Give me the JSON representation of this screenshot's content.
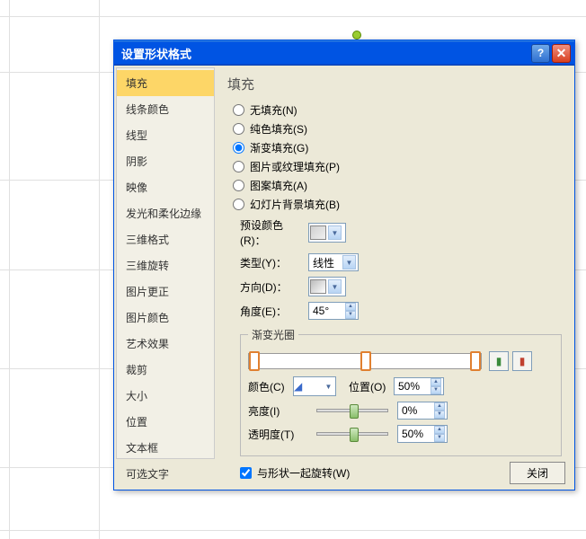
{
  "dialog": {
    "title": "设置形状格式"
  },
  "sidebar": {
    "items": [
      "填充",
      "线条颜色",
      "线型",
      "阴影",
      "映像",
      "发光和柔化边缘",
      "三维格式",
      "三维旋转",
      "图片更正",
      "图片颜色",
      "艺术效果",
      "裁剪",
      "大小",
      "位置",
      "文本框",
      "可选文字"
    ]
  },
  "content": {
    "heading": "填充",
    "radios": {
      "none": "无填充(N)",
      "solid": "纯色填充(S)",
      "gradient": "渐变填充(G)",
      "picture": "图片或纹理填充(P)",
      "pattern": "图案填充(A)",
      "slidebg": "幻灯片背景填充(B)"
    },
    "labels": {
      "preset": "预设颜色(R)：",
      "type": "类型(Y)：",
      "direction": "方向(D)：",
      "angle": "角度(E)：",
      "gstops": "渐变光圈",
      "color": "颜色(C)",
      "position": "位置(O)",
      "brightness": "亮度(I)",
      "transparency": "透明度(T)",
      "rotate": "与形状一起旋转(W)"
    },
    "values": {
      "type": "线性",
      "angle": "45°",
      "position": "50%",
      "brightness": "0%",
      "transparency": "50%"
    }
  },
  "footer": {
    "close": "关闭"
  }
}
